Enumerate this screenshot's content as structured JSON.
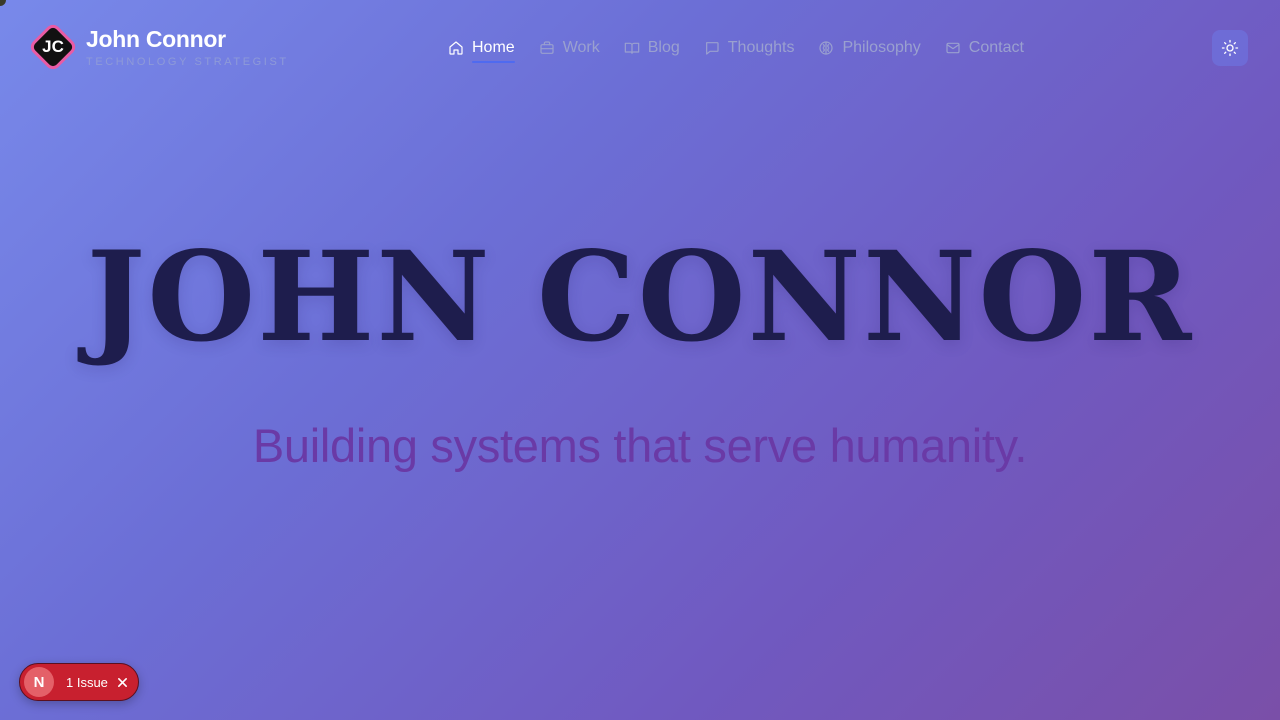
{
  "brand": {
    "initials": "JC",
    "name": "John Connor",
    "subtitle": "TECHNOLOGY STRATEGIST"
  },
  "nav": {
    "items": [
      {
        "label": "Home",
        "icon": "home-icon",
        "active": true
      },
      {
        "label": "Work",
        "icon": "briefcase-icon",
        "active": false
      },
      {
        "label": "Blog",
        "icon": "book-icon",
        "active": false
      },
      {
        "label": "Thoughts",
        "icon": "message-icon",
        "active": false
      },
      {
        "label": "Philosophy",
        "icon": "brain-icon",
        "active": false
      },
      {
        "label": "Contact",
        "icon": "mail-icon",
        "active": false
      }
    ]
  },
  "theme_toggle": {
    "icon": "sun-icon"
  },
  "hero": {
    "title": "JOHN CONNOR",
    "tagline": "Building systems that serve humanity."
  },
  "issue_badge": {
    "letter": "N",
    "text": "1 Issue"
  },
  "colors": {
    "accent": "#4f6af0",
    "logo_border": "#e95ba4",
    "title": "#1e1d4d",
    "tagline": "#6a3aa6",
    "issue_bg": "#c8202f"
  }
}
